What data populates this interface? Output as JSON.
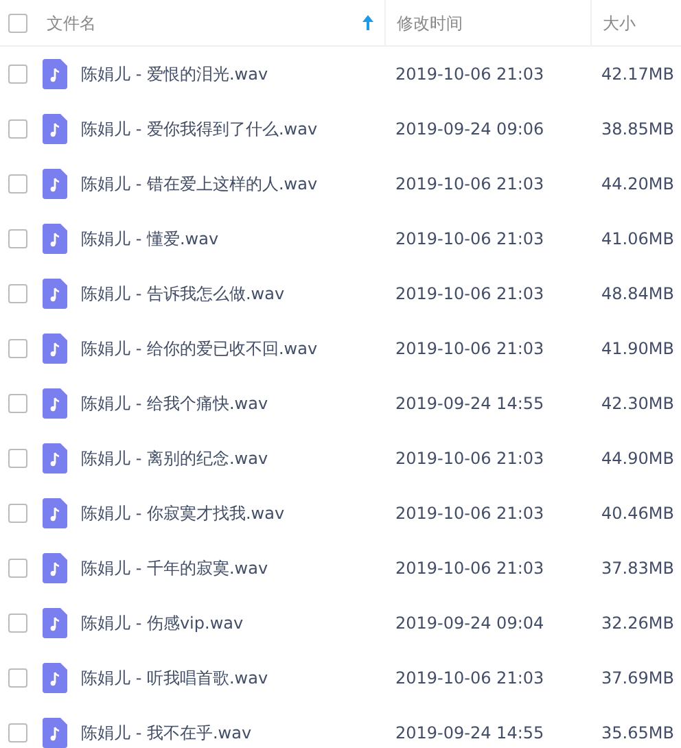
{
  "table": {
    "select_all": {
      "checked": false
    },
    "columns": [
      {
        "label": "文件名",
        "sorted": true
      },
      {
        "label": "修改时间",
        "sorted": false
      },
      {
        "label": "大小",
        "sorted": false
      }
    ],
    "rows": [
      {
        "checked": false,
        "name": "陈娟儿 - 爱恨的泪光.wav",
        "modified": "2019-10-06 21:03",
        "size": "42.17MB"
      },
      {
        "checked": false,
        "name": "陈娟儿 - 爱你我得到了什么.wav",
        "modified": "2019-09-24 09:06",
        "size": "38.85MB"
      },
      {
        "checked": false,
        "name": "陈娟儿 - 错在爱上这样的人.wav",
        "modified": "2019-10-06 21:03",
        "size": "44.20MB"
      },
      {
        "checked": false,
        "name": "陈娟儿 - 懂爱.wav",
        "modified": "2019-10-06 21:03",
        "size": "41.06MB"
      },
      {
        "checked": false,
        "name": "陈娟儿 - 告诉我怎么做.wav",
        "modified": "2019-10-06 21:03",
        "size": "48.84MB"
      },
      {
        "checked": false,
        "name": "陈娟儿 - 给你的爱已收不回.wav",
        "modified": "2019-10-06 21:03",
        "size": "41.90MB"
      },
      {
        "checked": false,
        "name": "陈娟儿 - 给我个痛快.wav",
        "modified": "2019-09-24 14:55",
        "size": "42.30MB"
      },
      {
        "checked": false,
        "name": "陈娟儿 - 离别的纪念.wav",
        "modified": "2019-10-06 21:03",
        "size": "44.90MB"
      },
      {
        "checked": false,
        "name": "陈娟儿 - 你寂寞才找我.wav",
        "modified": "2019-10-06 21:03",
        "size": "40.46MB"
      },
      {
        "checked": false,
        "name": "陈娟儿 - 千年的寂寞.wav",
        "modified": "2019-10-06 21:03",
        "size": "37.83MB"
      },
      {
        "checked": false,
        "name": "陈娟儿 - 伤感vip.wav",
        "modified": "2019-09-24 09:04",
        "size": "32.26MB"
      },
      {
        "checked": false,
        "name": "陈娟儿 - 听我唱首歌.wav",
        "modified": "2019-10-06 21:03",
        "size": "37.69MB"
      },
      {
        "checked": false,
        "name": "陈娟儿 - 我不在乎.wav",
        "modified": "2019-09-24 14:55",
        "size": "35.65MB"
      }
    ]
  }
}
